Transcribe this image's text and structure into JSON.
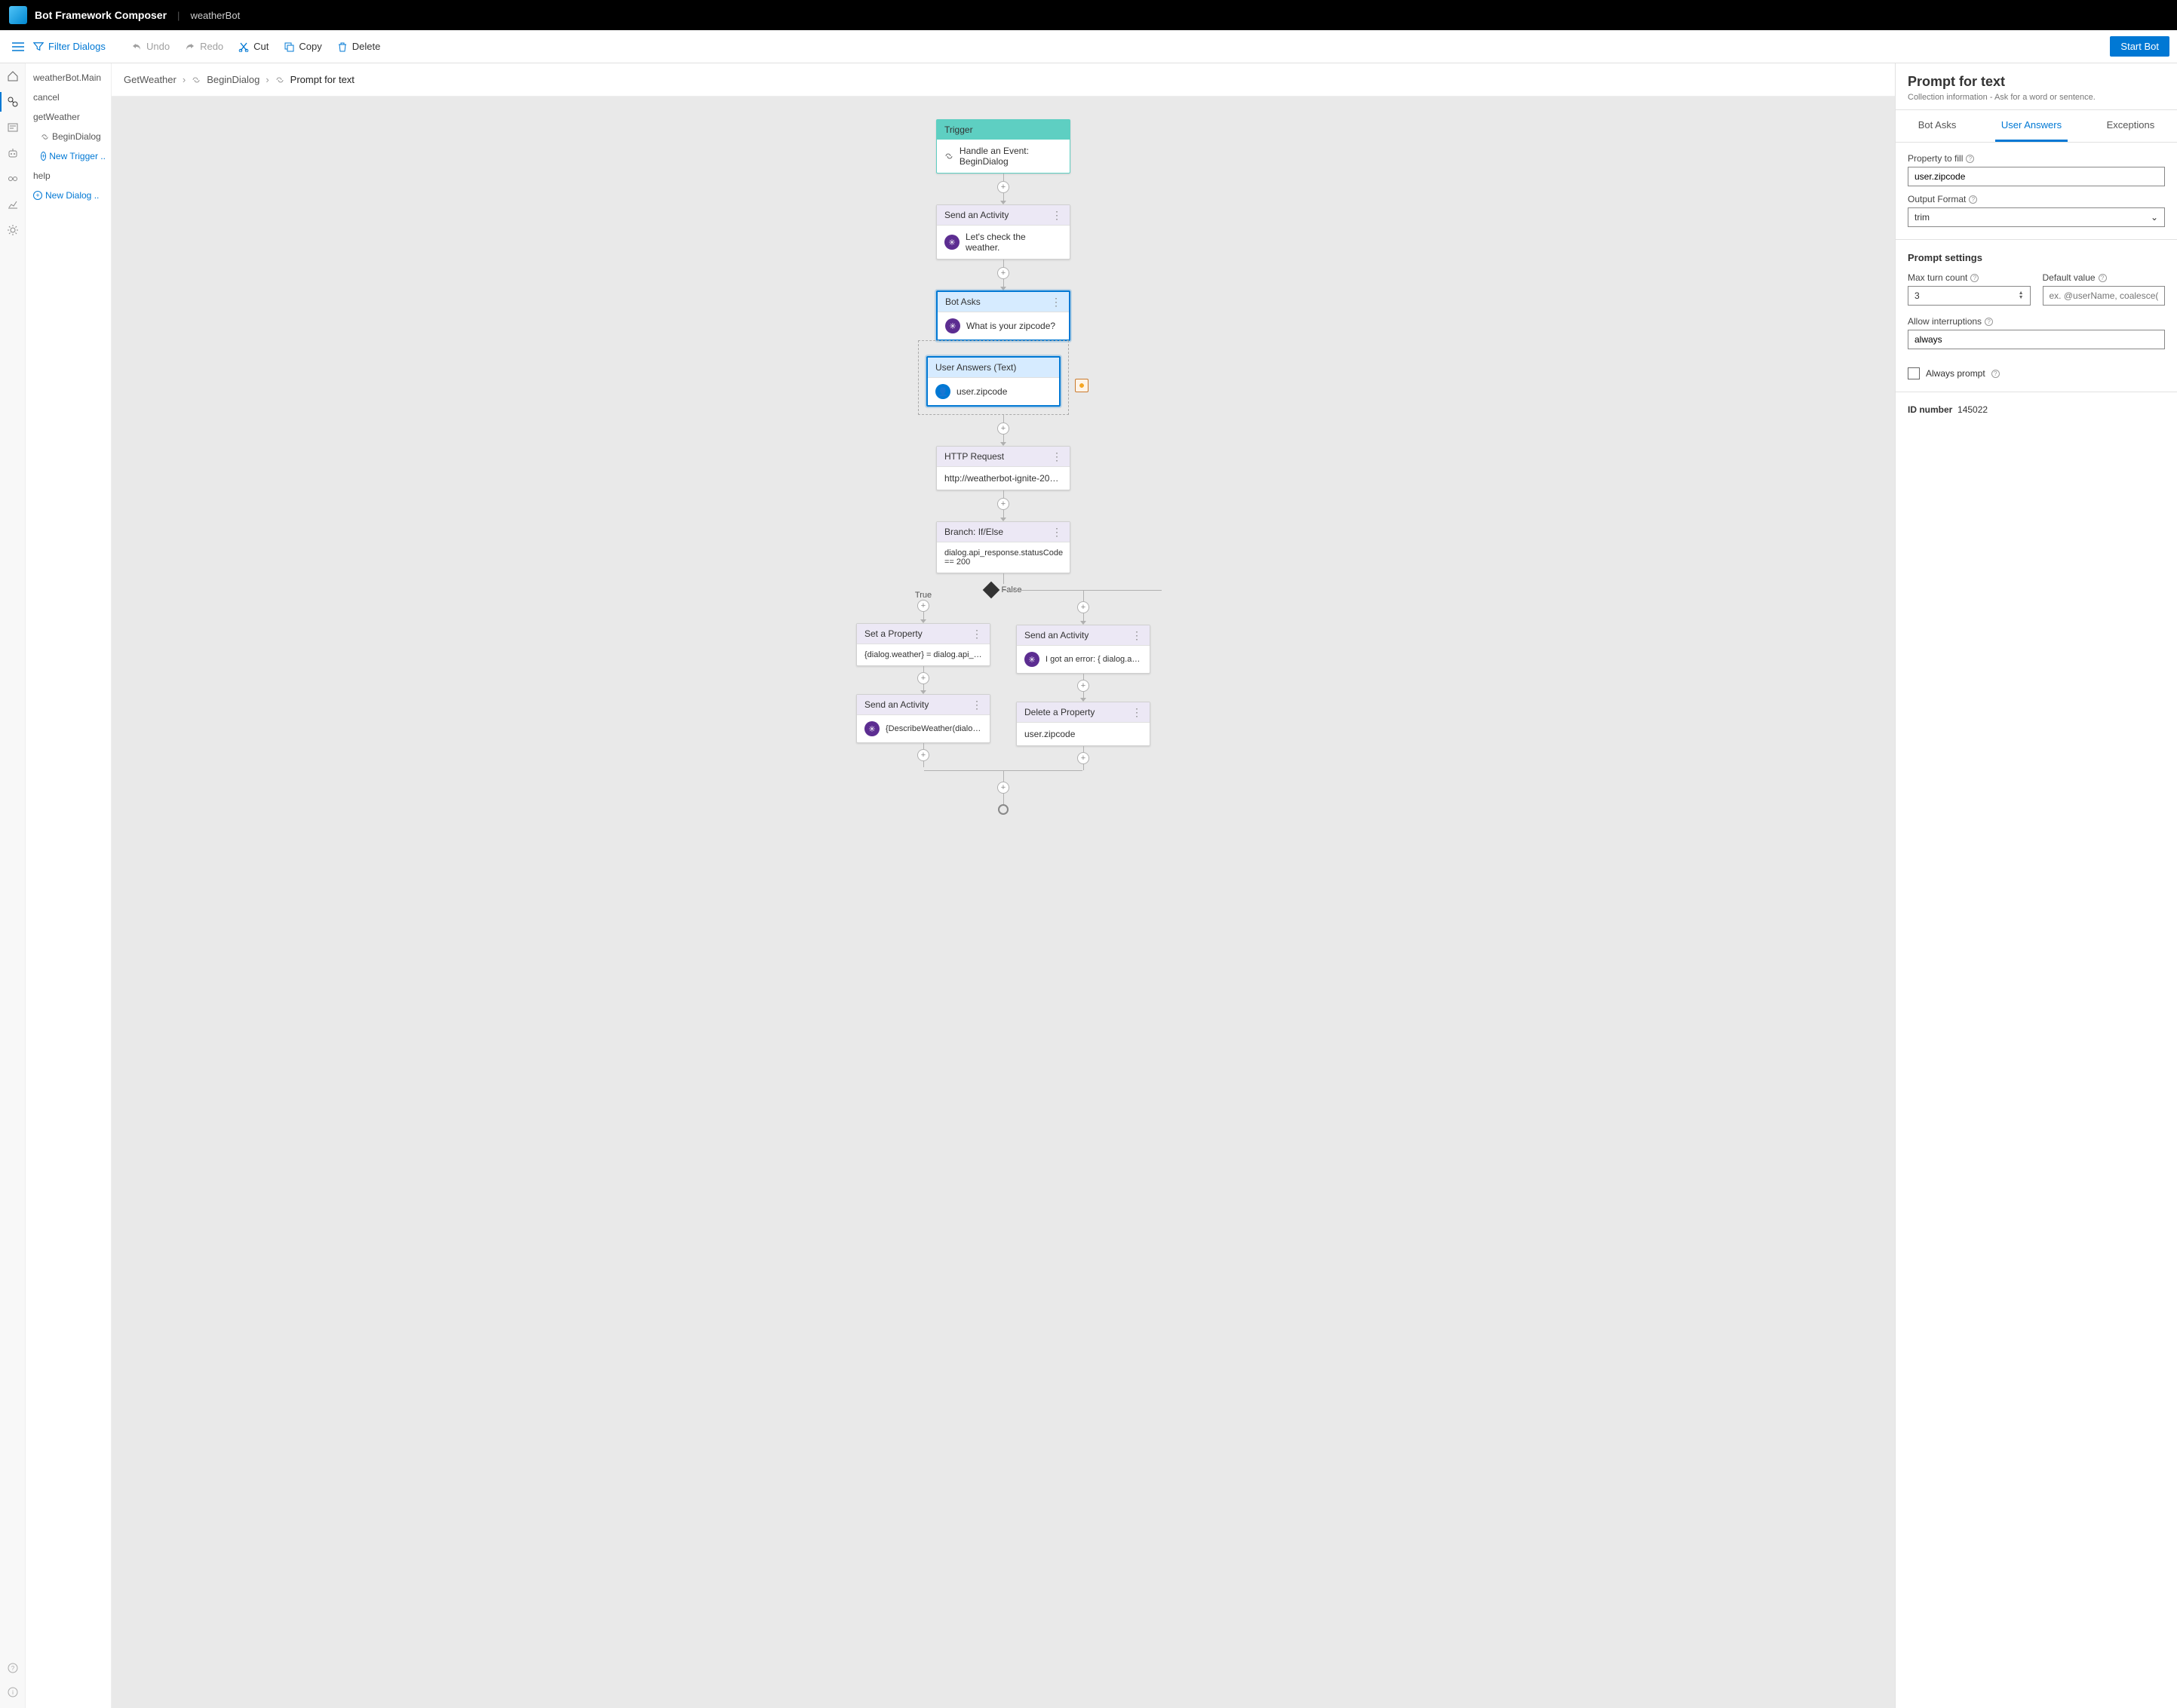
{
  "header": {
    "brand": "Bot Framework Composer",
    "project": "weatherBot"
  },
  "toolbar": {
    "filter": "Filter Dialogs",
    "undo": "Undo",
    "redo": "Redo",
    "cut": "Cut",
    "copy": "Copy",
    "delete": "Delete",
    "start": "Start Bot"
  },
  "sidebar": {
    "items": [
      "weatherBot.Main",
      "cancel",
      "getWeather"
    ],
    "sub": "BeginDialog",
    "newTrigger": "New Trigger ..",
    "help": "help",
    "newDialog": "New Dialog .."
  },
  "breadcrumb": {
    "a": "GetWeather",
    "b": "BeginDialog",
    "c": "Prompt for text"
  },
  "flow": {
    "trigger": {
      "title": "Trigger",
      "body": "Handle an Event: BeginDialog"
    },
    "sendActivity1": {
      "title": "Send an Activity",
      "body": "Let's check the weather."
    },
    "botAsks": {
      "title": "Bot Asks",
      "body": "What is your zipcode?"
    },
    "userAnswers": {
      "title": "User Answers (Text)",
      "body": "user.zipcode"
    },
    "httpReq": {
      "title": "HTTP Request",
      "body": "http://weatherbot-ignite-2019.azurew..."
    },
    "branch": {
      "title": "Branch: If/Else",
      "body": "dialog.api_response.statusCode == 200",
      "falseLabel": "False",
      "trueLabel": "True"
    },
    "setProp": {
      "title": "Set a Property",
      "body": "{dialog.weather} = dialog.api_respons..."
    },
    "sendActivity2": {
      "title": "Send an Activity",
      "body": "I got an error: { dialog.api_response..."
    },
    "sendActivity3": {
      "title": "Send an Activity",
      "body": "{DescribeWeather(dialog.weather)} ..."
    },
    "delProp": {
      "title": "Delete a Property",
      "body": "user.zipcode"
    }
  },
  "panel": {
    "title": "Prompt for text",
    "subtitle": "Collection information - Ask for a word or sentence.",
    "tabs": {
      "a": "Bot Asks",
      "b": "User Answers",
      "c": "Exceptions"
    },
    "propertyLabel": "Property to fill",
    "propertyValue": "user.zipcode",
    "outputFormatLabel": "Output Format",
    "outputFormatValue": "trim",
    "promptSettings": "Prompt settings",
    "maxTurnLabel": "Max turn count",
    "maxTurnValue": "3",
    "defaultValueLabel": "Default value",
    "defaultValuePh": "ex. @userName, coalesce(@number, ...",
    "allowInterruptLabel": "Allow interruptions",
    "allowInterruptValue": "always",
    "alwaysPrompt": "Always prompt",
    "idLabel": "ID number",
    "idValue": "145022"
  }
}
